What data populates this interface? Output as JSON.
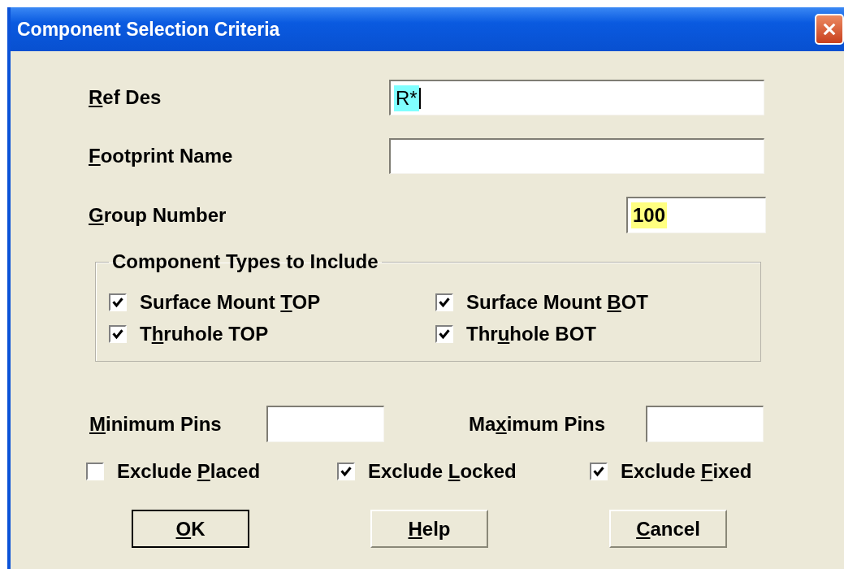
{
  "window": {
    "title": "Component Selection Criteria"
  },
  "fields": [
    {
      "kind": "text",
      "label": {
        "key": "R",
        "post": "ef Des"
      },
      "value": "R*",
      "color": "#80ffff",
      "focused": true
    },
    {
      "kind": "text",
      "label": {
        "key": "F",
        "post": "ootprint Name"
      },
      "focused": false
    },
    {
      "kind": "number",
      "label": {
        "key": "G",
        "post": "roup Number"
      },
      "value": "100",
      "color": "#ffff80",
      "focused": false
    }
  ],
  "component_types": {
    "title": "Component Types to Include",
    "options": [
      {
        "label": {
          "pre": "Surface Mount ",
          "key": "T",
          "post": "OP"
        },
        "checked": true
      },
      {
        "label": {
          "pre": "Surface Mount ",
          "key": "B",
          "post": "OT"
        },
        "checked": true
      },
      {
        "label": {
          "pre": "T",
          "key": "h",
          "post": "ruhole TOP"
        },
        "checked": true
      },
      {
        "label": {
          "pre": "Thr",
          "key": "u",
          "post": "hole BOT"
        },
        "checked": true
      }
    ]
  },
  "pins": [
    {
      "label": {
        "key": "M",
        "post": "inimum Pins"
      }
    },
    {
      "label": {
        "pre": "Ma",
        "key": "x",
        "post": "imum Pins"
      }
    }
  ],
  "exclude": [
    {
      "label": {
        "pre": "Exclude ",
        "key": "P",
        "post": "laced"
      },
      "checked": false
    },
    {
      "label": {
        "pre": "Exclude ",
        "key": "L",
        "post": "ocked"
      },
      "checked": true
    },
    {
      "label": {
        "pre": "Exclude ",
        "key": "F",
        "post": "ixed"
      },
      "checked": true
    }
  ],
  "buttons": [
    {
      "label": {
        "key": "O",
        "post": "K"
      },
      "default": true
    },
    {
      "label": {
        "key": "H",
        "post": "elp"
      },
      "default": false
    },
    {
      "label": {
        "key": "C",
        "post": "ancel"
      },
      "default": false
    }
  ]
}
